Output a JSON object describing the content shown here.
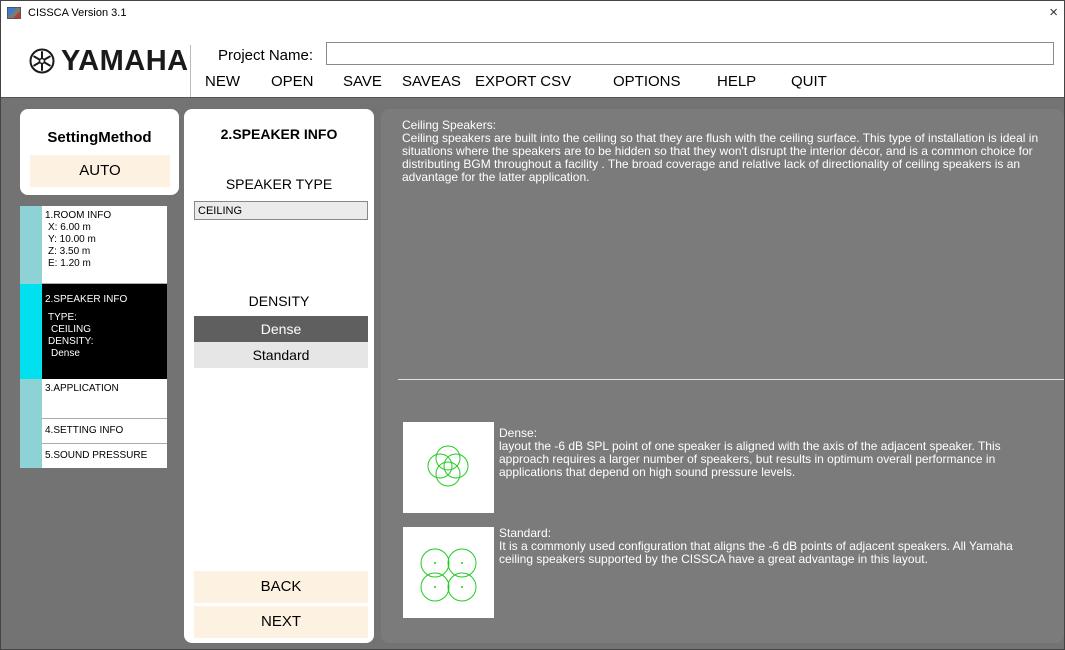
{
  "window": {
    "title": "CISSCA Version 3.1",
    "close_glyph": "×"
  },
  "header": {
    "brand": "YAMAHA",
    "project_label": "Project Name:",
    "project_value": "",
    "menu": [
      "NEW",
      "OPEN",
      "SAVE",
      "SAVEAS",
      "EXPORT CSV",
      "OPTIONS",
      "HELP",
      "QUIT"
    ]
  },
  "left": {
    "method_title": "SettingMethod",
    "method_value": "AUTO",
    "steps": {
      "room": {
        "title": "1.ROOM INFO",
        "x": "X: 6.00 m",
        "y": "Y: 10.00 m",
        "z": "Z: 3.50 m",
        "e": "E: 1.20 m"
      },
      "speaker": {
        "title": "2.SPEAKER INFO",
        "type_label": "TYPE:",
        "type_value": "CEILING",
        "density_label": "DENSITY:",
        "density_value": "Dense"
      },
      "application": {
        "title": "3.APPLICATION"
      },
      "setting": {
        "title": "4.SETTING INFO"
      },
      "sound": {
        "title": "5.SOUND PRESSURE"
      }
    }
  },
  "middle": {
    "title": "2.SPEAKER INFO",
    "speaker_type_label": "SPEAKER TYPE",
    "speaker_type_value": "CEILING",
    "density_label": "DENSITY",
    "density_options": [
      "Dense",
      "Standard"
    ],
    "density_selected": "Dense",
    "back": "BACK",
    "next": "NEXT"
  },
  "right": {
    "description_title": "Ceiling Speakers:",
    "description": "Ceiling speakers are built into the ceiling so that they are flush with the ceiling surface. This type of installation is ideal in situations where the speakers are to be hidden so that they won't disrupt the interior décor, and is a common choice for distributing BGM throughout a facility . The broad coverage and relative lack of directionality of ceiling speakers is an advantage for the latter application.",
    "dense_title": "Dense:",
    "dense_text": "layout the -6 dB SPL point of one speaker is aligned with the axis of the adjacent speaker. This approach requires a larger number of speakers, but results in optimum overall performance in applications that depend on high sound pressure levels.",
    "standard_title": "Standard:",
    "standard_text": "It is a commonly used configuration that aligns the -6 dB points of adjacent speakers. All Yamaha ceiling speakers supported by the CISSCA have a great advantage in this layout."
  },
  "colors": {
    "main_bg": "#737373",
    "right_panel_bg": "#7b7b7b",
    "step_bar": "#8dd3d6",
    "step_bar_active": "#00e0ee",
    "button_cream": "#fdf1e1",
    "selected_dark": "#5f5f5f",
    "circle_green": "#22cc22"
  },
  "icons": [
    "app-icon",
    "yamaha-tuning-fork-logo",
    "close-icon",
    "dense-layout-icon",
    "standard-layout-icon"
  ]
}
